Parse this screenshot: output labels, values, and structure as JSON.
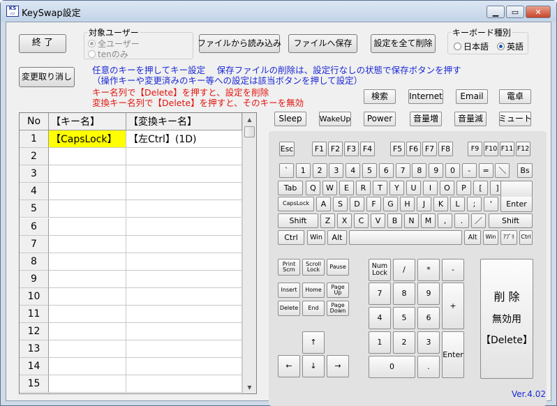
{
  "window": {
    "title": "KeySwap設定",
    "version": "Ver.4.02"
  },
  "toolbar": {
    "exit": "終 了",
    "load": "ファイルから読み込み",
    "save": "ファイルへ保存",
    "delete_all": "設定を全て削除",
    "undo": "変更取り消し"
  },
  "target_user": {
    "legend": "対象ユーザー",
    "options": [
      "全ユーザー",
      "tenのみ"
    ],
    "selected": "全ユーザー"
  },
  "keyboard_type": {
    "legend": "キーボード種別",
    "options": [
      "日本語",
      "英語"
    ],
    "selected": "英語"
  },
  "info": {
    "line1": "任意のキーを押してキー設定　 保存ファイルの削除は、設定行なしの状態で保存ボタンを押す",
    "line2": "（操作キーや変更済みのキー等への設定は該当ボタンを押して設定）",
    "line3": "キー名列で【Delete】を押すと、設定を削除",
    "line4": "変換キー名列で【Delete】を押すと、そのキーを無効"
  },
  "special_keys": {
    "row1": [
      "検索",
      "Internet",
      "Email",
      "電卓"
    ],
    "row2": [
      "Sleep",
      "WakeUp",
      "Power",
      "音量増",
      "音量減",
      "ミュート"
    ]
  },
  "grid": {
    "headers": [
      "No",
      "【キー名】",
      "【変換キー名】"
    ],
    "rows": [
      {
        "no": "1",
        "key": "【CapsLock】",
        "to": "【左Ctrl】(1D)"
      },
      {
        "no": "2",
        "key": "",
        "to": ""
      },
      {
        "no": "3",
        "key": "",
        "to": ""
      },
      {
        "no": "4",
        "key": "",
        "to": ""
      },
      {
        "no": "5",
        "key": "",
        "to": ""
      },
      {
        "no": "6",
        "key": "",
        "to": ""
      },
      {
        "no": "7",
        "key": "",
        "to": ""
      },
      {
        "no": "8",
        "key": "",
        "to": ""
      },
      {
        "no": "9",
        "key": "",
        "to": ""
      },
      {
        "no": "10",
        "key": "",
        "to": ""
      },
      {
        "no": "11",
        "key": "",
        "to": ""
      },
      {
        "no": "12",
        "key": "",
        "to": ""
      },
      {
        "no": "13",
        "key": "",
        "to": ""
      },
      {
        "no": "14",
        "key": "",
        "to": ""
      },
      {
        "no": "15",
        "key": "",
        "to": ""
      }
    ]
  },
  "keyboard": {
    "fn_row": [
      "Esc",
      "F1",
      "F2",
      "F3",
      "F4",
      "F5",
      "F6",
      "F7",
      "F8",
      "F9",
      "F10",
      "F11",
      "F12"
    ],
    "num_row": [
      "`",
      "1",
      "2",
      "3",
      "4",
      "5",
      "6",
      "7",
      "8",
      "9",
      "0",
      "-",
      "=",
      "＼",
      "Bs"
    ],
    "q_row": [
      "Tab",
      "Q",
      "W",
      "E",
      "R",
      "T",
      "Y",
      "U",
      "I",
      "O",
      "P",
      "[",
      "]"
    ],
    "a_row": [
      "CapsLock",
      "A",
      "S",
      "D",
      "F",
      "G",
      "H",
      "J",
      "K",
      "L",
      ";",
      "'",
      "Enter"
    ],
    "z_row": [
      "Shift",
      "Z",
      "X",
      "C",
      "V",
      "B",
      "N",
      "M",
      ",",
      ".",
      "／",
      "Shift"
    ],
    "bottom_row": [
      "Ctrl",
      "Win",
      "Alt",
      "",
      "Alt",
      "Win",
      "ｱﾌﾟﾘ",
      "Ctrl"
    ],
    "nav": [
      "Print Scrn",
      "Scroll Lock",
      "Pause",
      "Insert",
      "Home",
      "Page Up",
      "Delete",
      "End",
      "Page Down"
    ],
    "arrows": [
      "↑",
      "←",
      "↓",
      "→"
    ],
    "numpad": [
      "Num Lock",
      "/",
      "*",
      "-",
      "7",
      "8",
      "9",
      "+",
      "4",
      "5",
      "6",
      "1",
      "2",
      "3",
      "Enter",
      "0",
      "."
    ],
    "delete_big": {
      "line1": "削 除",
      "line2": "無効用",
      "line3": "【Delete】"
    }
  }
}
